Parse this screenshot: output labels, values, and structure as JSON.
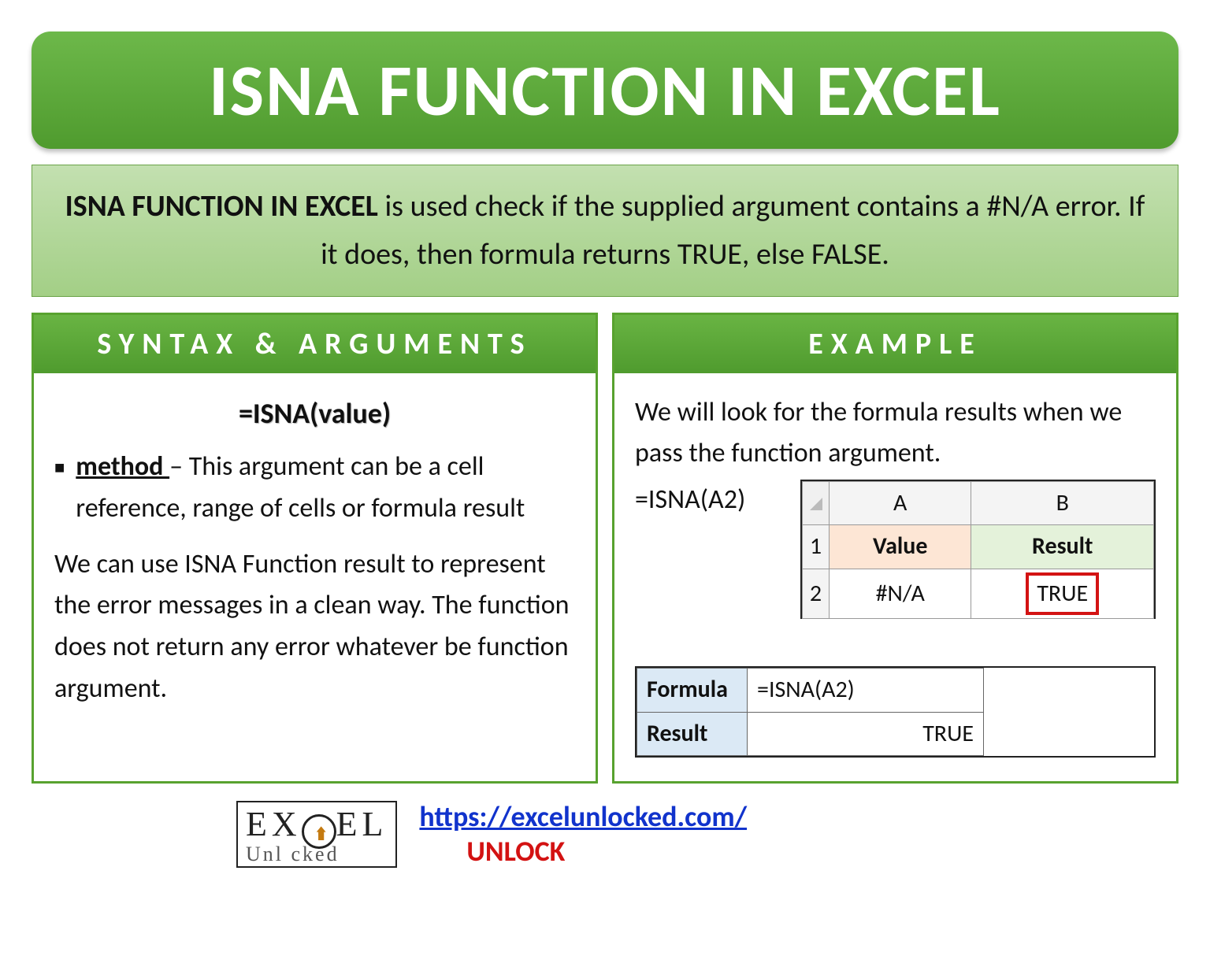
{
  "title": "ISNA FUNCTION IN EXCEL",
  "description": {
    "bold": "ISNA FUNCTION IN EXCEL",
    "rest": " is used check if the supplied argument contains a #N/A error. If it does, then formula returns TRUE, else FALSE."
  },
  "left": {
    "header": "SYNTAX & ARGUMENTS",
    "formula": "=ISNA(value)",
    "arg_name": "method ",
    "arg_desc": "– This argument can be a cell reference, range of cells or formula result",
    "note": "We can use ISNA Function result to represent the error messages in a clean way. The function does not return any error whatever be function argument."
  },
  "right": {
    "header": "EXAMPLE",
    "intro": "We will look for the formula results when we pass the function argument.",
    "formula_sample": "=ISNA(A2)",
    "sheet": {
      "colA": "A",
      "colB": "B",
      "row1": "1",
      "row2": "2",
      "h_value": "Value",
      "h_result": "Result",
      "v_a2": "#N/A",
      "v_b2": "TRUE"
    },
    "mini": {
      "formula_label": "Formula",
      "formula_value": "=ISNA(A2)",
      "result_label": "Result",
      "result_value": "TRUE"
    }
  },
  "footer": {
    "logo_top_left": "EX",
    "logo_top_right": "EL",
    "logo_bottom": "Unl   cked",
    "url": "https://excelunlocked.com/",
    "unlock": "UNLOCK"
  }
}
